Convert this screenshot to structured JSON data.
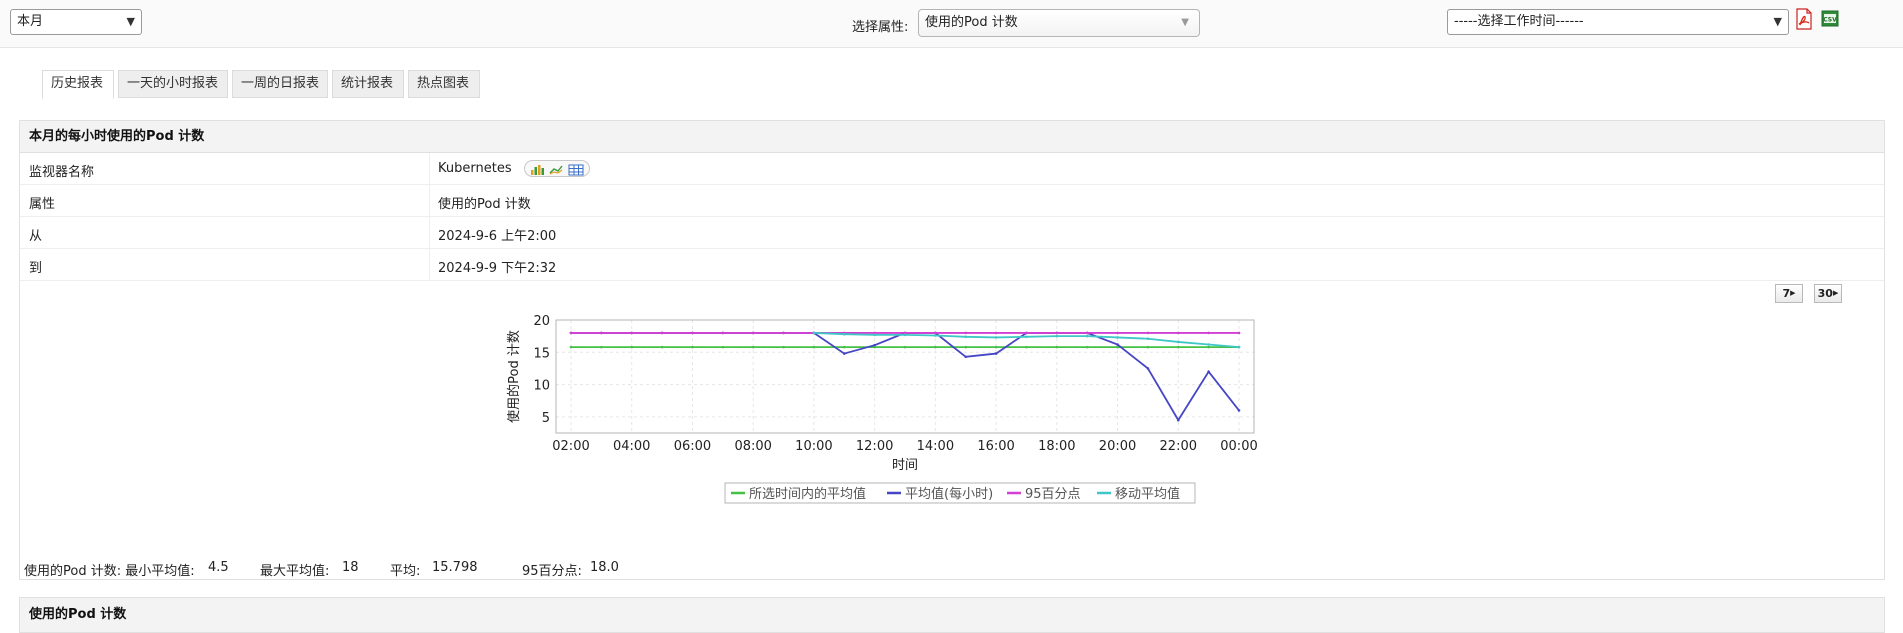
{
  "toolbar": {
    "period_select": "本月",
    "attribute_label": "选择属性:",
    "attribute_select": "使用的Pod 计数",
    "worktime_select": "-----选择工作时间------",
    "pdf_icon": "pdf-icon",
    "csv_icon": "csv-icon"
  },
  "tabs": [
    {
      "label": "历史报表",
      "active": true
    },
    {
      "label": "一天的小时报表",
      "active": false
    },
    {
      "label": "一周的日报表",
      "active": false
    },
    {
      "label": "统计报表",
      "active": false
    },
    {
      "label": "热点图表",
      "active": false
    }
  ],
  "report": {
    "title": "本月的每小时使用的Pod 计数",
    "rows": [
      {
        "key": "监视器名称",
        "value": "Kubernetes"
      },
      {
        "key": "属性",
        "value": "使用的Pod 计数"
      },
      {
        "key": "从",
        "value": "2024-9-6 上午2:00"
      },
      {
        "key": "到",
        "value": "2024-9-9 下午2:32"
      }
    ],
    "range_buttons": [
      "7",
      "30"
    ],
    "stats": {
      "min_label": "使用的Pod 计数: 最小平均值:",
      "min_value": "4.5",
      "max_label": "最大平均值:",
      "max_value": "18",
      "avg_label": "平均:",
      "avg_value": "15.798",
      "p95_label": "95百分点:",
      "p95_value": "18.0"
    }
  },
  "section2": {
    "title": "使用的Pod 计数"
  },
  "colors": {
    "selected_avg": "#44c144",
    "hourly_avg": "#4545c6",
    "p95": "#d23fd2",
    "moving_avg": "#3fc6c6"
  },
  "chart_data": {
    "type": "line",
    "xlabel": "时间",
    "ylabel": "使用的Pod 计数",
    "x": [
      "02:00",
      "03:00",
      "04:00",
      "05:00",
      "06:00",
      "07:00",
      "08:00",
      "09:00",
      "10:00",
      "11:00",
      "12:00",
      "13:00",
      "14:00",
      "15:00",
      "16:00",
      "17:00",
      "18:00",
      "19:00",
      "20:00",
      "21:00",
      "22:00",
      "23:00",
      "00:00"
    ],
    "xticks": [
      "02:00",
      "04:00",
      "06:00",
      "08:00",
      "10:00",
      "12:00",
      "14:00",
      "16:00",
      "18:00",
      "20:00",
      "22:00",
      "00:00"
    ],
    "yticks": [
      5,
      10,
      15,
      20
    ],
    "ylim": [
      2.5,
      20
    ],
    "grid": true,
    "legend_position": "bottom",
    "series": [
      {
        "name": "所选时间内的平均值",
        "color": "#44c144",
        "values": [
          15.8,
          15.8,
          15.8,
          15.8,
          15.8,
          15.8,
          15.8,
          15.8,
          15.8,
          15.8,
          15.8,
          15.8,
          15.8,
          15.8,
          15.8,
          15.8,
          15.8,
          15.8,
          15.8,
          15.8,
          15.8,
          15.8,
          15.8
        ]
      },
      {
        "name": "平均值(每小时)",
        "color": "#4545c6",
        "values": [
          18,
          18,
          18,
          18,
          18,
          18,
          18,
          18,
          18,
          14.8,
          16.1,
          18,
          18,
          14.3,
          14.8,
          18,
          18,
          18,
          16.2,
          12.5,
          4.5,
          12,
          6
        ]
      },
      {
        "name": "95百分点",
        "color": "#d23fd2",
        "values": [
          18,
          18,
          18,
          18,
          18,
          18,
          18,
          18,
          18,
          18,
          18,
          18,
          18,
          18,
          18,
          18,
          18,
          18,
          18,
          18,
          18,
          18,
          18
        ]
      },
      {
        "name": "移动平均值",
        "color": "#3fc6c6",
        "values": [
          null,
          null,
          null,
          null,
          null,
          null,
          null,
          null,
          18,
          17.8,
          17.7,
          17.7,
          17.6,
          17.4,
          17.3,
          17.4,
          17.5,
          17.5,
          17.3,
          17.1,
          16.6,
          16.2,
          15.8
        ]
      }
    ]
  }
}
